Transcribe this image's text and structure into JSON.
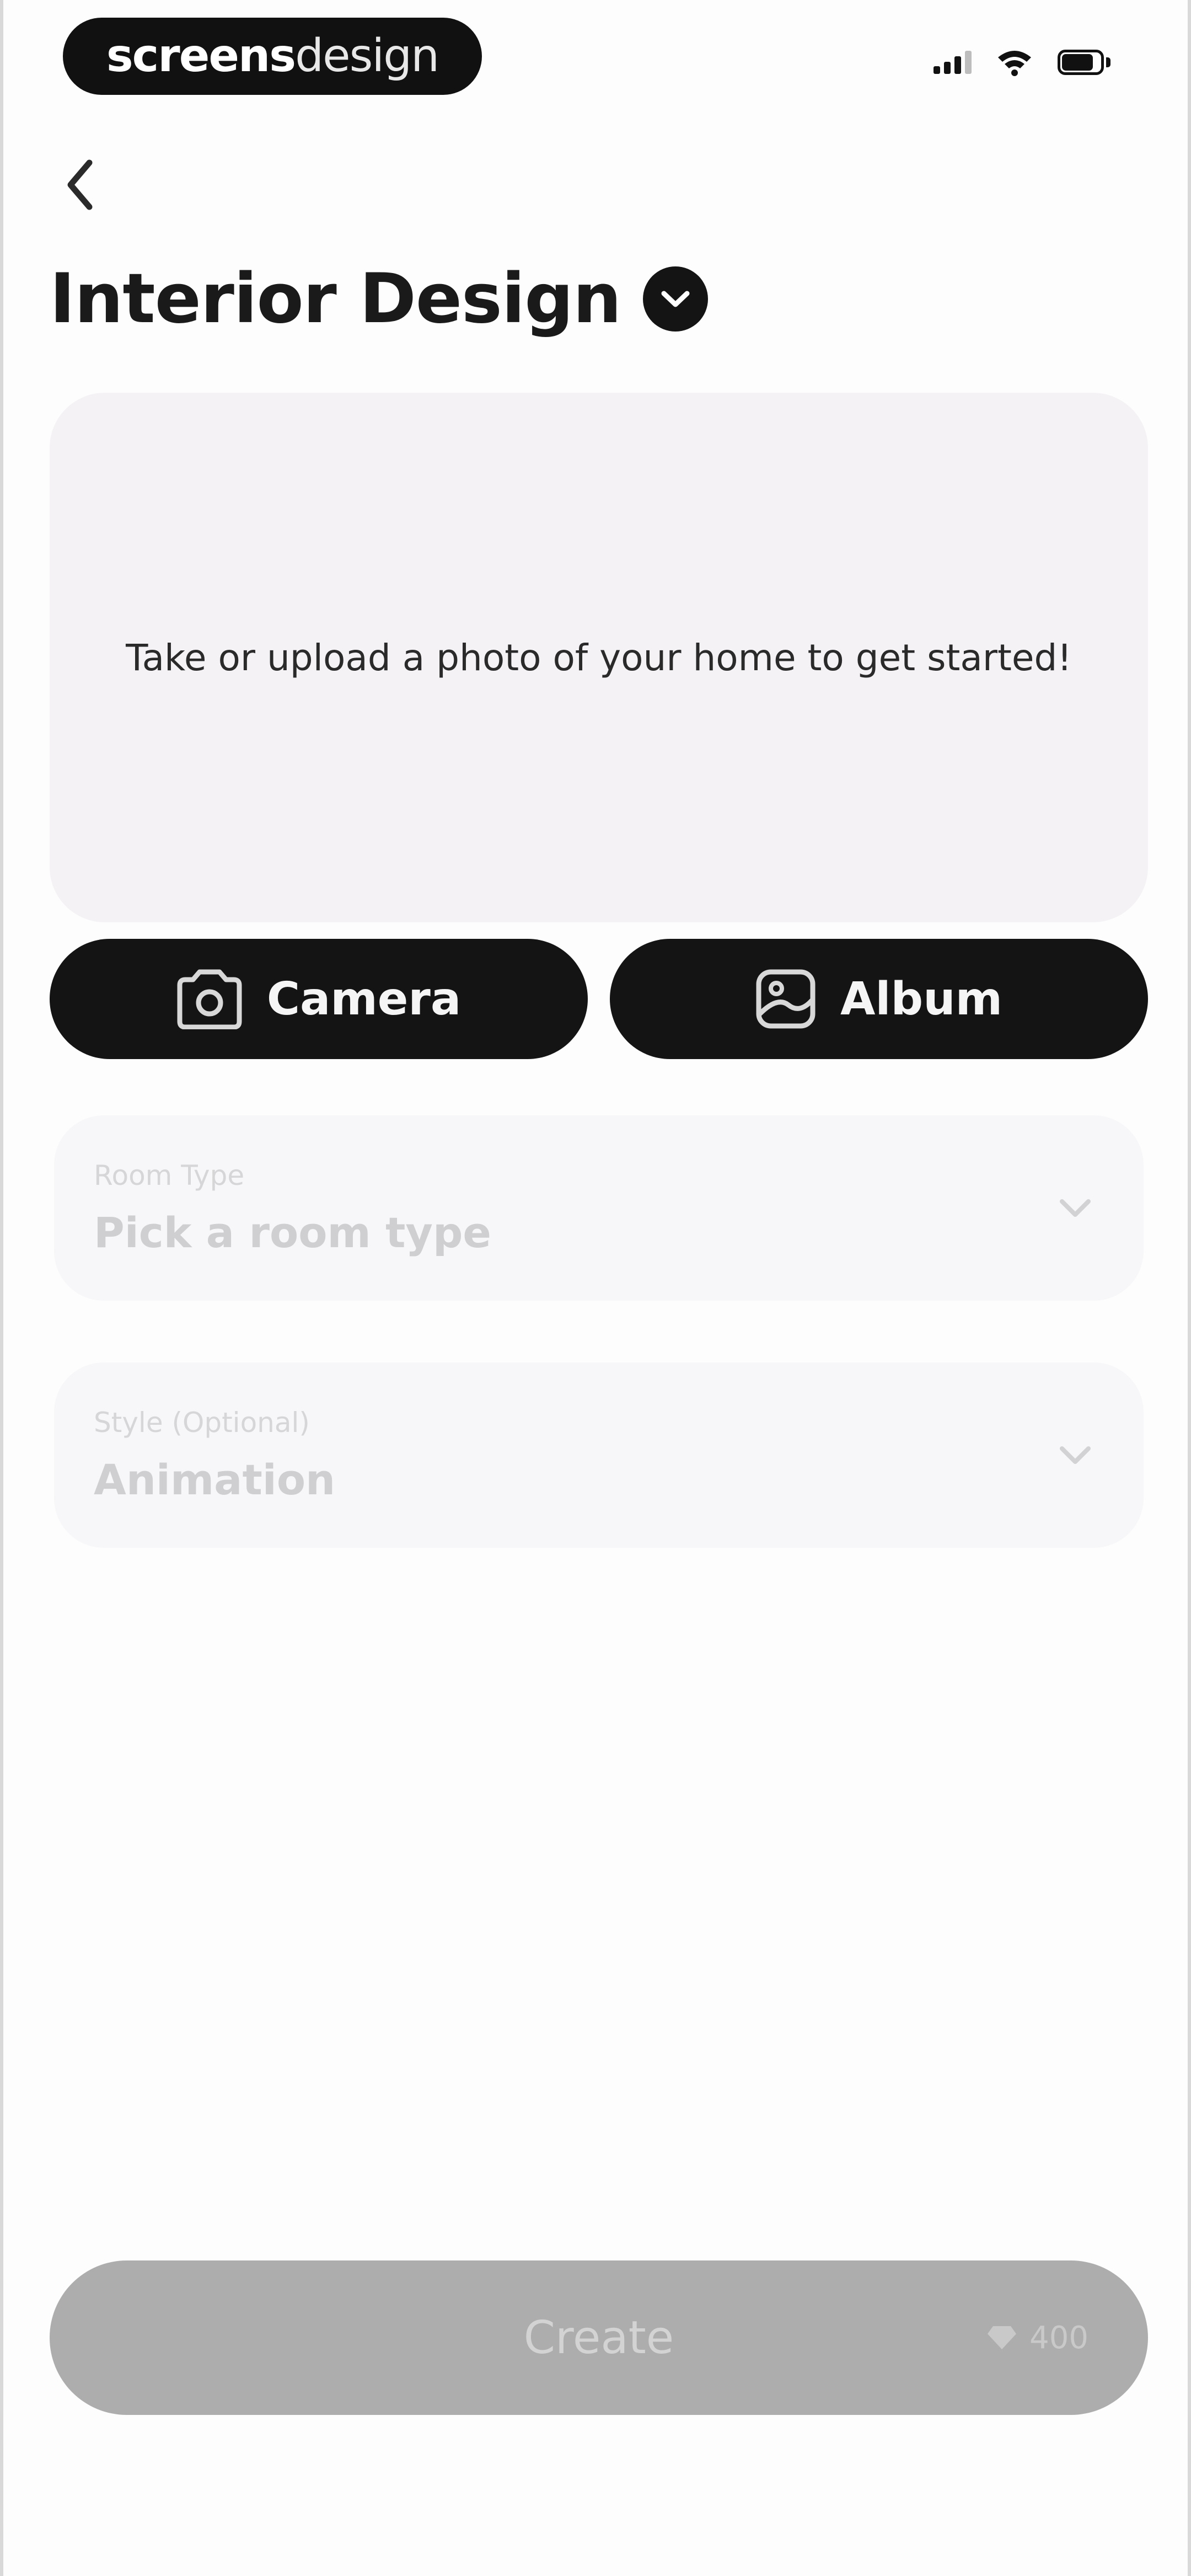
{
  "status_bar": {
    "brand_bold": "screens",
    "brand_light": "design"
  },
  "header": {
    "title": "Interior Design"
  },
  "upload": {
    "prompt": "Take or upload a photo of your home to get started!"
  },
  "buttons": {
    "camera_label": "Camera",
    "album_label": "Album"
  },
  "room_type": {
    "label": "Room Type",
    "placeholder": "Pick a room type"
  },
  "style": {
    "label": "Style (Optional)",
    "value": "Animation"
  },
  "create": {
    "label": "Create",
    "cost": "400"
  },
  "icons": {
    "back": "chevron-left-icon",
    "title_dropdown": "chevron-down-circle-icon",
    "camera": "camera-icon",
    "album": "photo-album-icon",
    "select_chevron": "chevron-down-icon",
    "cost": "diamond-icon"
  },
  "colors": {
    "primary": "#141414",
    "upload_bg": "#f4f2f5",
    "field_bg": "#f7f7f9",
    "create_disabled": "#adadad"
  }
}
